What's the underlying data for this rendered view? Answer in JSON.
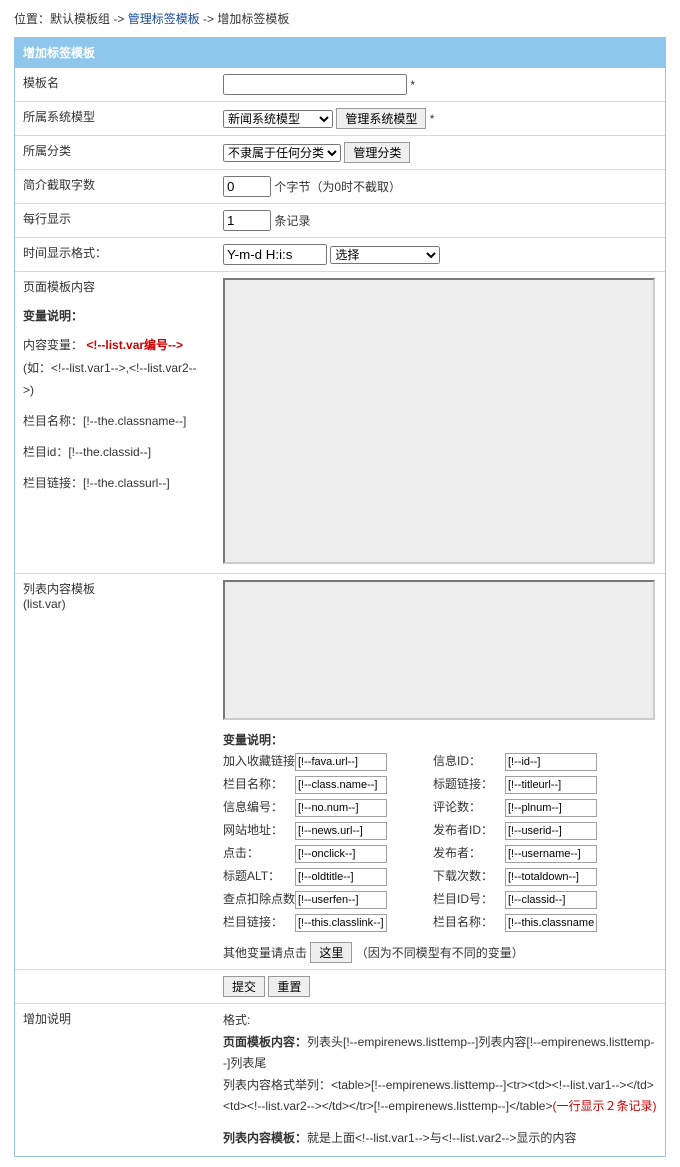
{
  "breadcrumb": {
    "prefix": "位置：默认模板组 -> ",
    "link": "管理标签模板",
    "sep": " -> ",
    "current": "增加标签模板"
  },
  "panel_title": "增加标签模板",
  "rows": {
    "tpl_name": {
      "label": "模板名",
      "value": "",
      "star": "*"
    },
    "sys_model": {
      "label": "所属系统模型",
      "selected": "新闻系统模型",
      "btn": "管理系统模型",
      "star": "*"
    },
    "category": {
      "label": "所属分类",
      "selected": "不隶属于任何分类",
      "btn": "管理分类"
    },
    "brief_len": {
      "label": "简介截取字数",
      "value": "0",
      "suffix": "个字节（为0时不截取）"
    },
    "per_line": {
      "label": "每行显示",
      "value": "1",
      "suffix": "条记录"
    },
    "time_fmt": {
      "label": "时间显示格式：",
      "value": "Y-m-d H:i:s",
      "select_placeholder": "选择"
    },
    "page_tpl": {
      "label": "页面模板内容",
      "vars_title": "变量说明：",
      "content_var_label": "内容变量：",
      "content_var_value": "<!--list.var编号-->",
      "content_var_eg": "(如：<!--list.var1-->,<!--list.var2-->)",
      "col_name": "栏目名称：[!--the.classname--]",
      "col_id": "栏目id：[!--the.classid--]",
      "col_link": "栏目链接：[!--the.classurl--]"
    },
    "list_tpl": {
      "label": "列表内容模板",
      "sub": "(list.var)",
      "vars_title": "变量说明：",
      "left": [
        {
          "lbl": "加入收藏链接：",
          "val": "[!--fava.url--]"
        },
        {
          "lbl": "栏目名称：",
          "val": "[!--class.name--]"
        },
        {
          "lbl": "信息编号：",
          "val": "[!--no.num--]"
        },
        {
          "lbl": "网站地址：",
          "val": "[!--news.url--]"
        },
        {
          "lbl": "点击：",
          "val": "[!--onclick--]"
        },
        {
          "lbl": "标题ALT：",
          "val": "[!--oldtitle--]"
        },
        {
          "lbl": "查点扣除点数：",
          "val": "[!--userfen--]"
        },
        {
          "lbl": "栏目链接：",
          "val": "[!--this.classlink--]"
        }
      ],
      "right": [
        {
          "lbl": "信息ID：",
          "val": "[!--id--]"
        },
        {
          "lbl": "标题链接：",
          "val": "[!--titleurl--]"
        },
        {
          "lbl": "评论数：",
          "val": "[!--plnum--]"
        },
        {
          "lbl": "发布者ID：",
          "val": "[!--userid--]"
        },
        {
          "lbl": "发布者：",
          "val": "[!--username--]"
        },
        {
          "lbl": "下载次数：",
          "val": "[!--totaldown--]"
        },
        {
          "lbl": "栏目ID号：",
          "val": "[!--classid--]"
        },
        {
          "lbl": "栏目名称：",
          "val": "[!--this.classname--]"
        }
      ],
      "other_vars_prefix": "其他变量请点击",
      "other_vars_btn": "这里",
      "other_vars_suffix": "（因为不同模型有不同的变量）"
    },
    "submit_row": {
      "submit": "提交",
      "reset": "重置"
    },
    "notes": {
      "label": "增加说明",
      "fmt": "格式:",
      "line1a": "页面模板内容：",
      "line1b": "列表头[!--empirenews.listtemp--]列表内容[!--empirenews.listtemp--]列表尾",
      "line2": "列表内容格式举列：<table>[!--empirenews.listtemp--]<tr><td><!--list.var1--></td><td><!--list.var2--></td></tr>[!--empirenews.listtemp--]</table>",
      "line2_hl": "(一行显示２条记录)",
      "line3a": "列表内容模板：",
      "line3b": "就是上面<!--list.var1-->与<!--list.var2-->显示的内容"
    }
  }
}
